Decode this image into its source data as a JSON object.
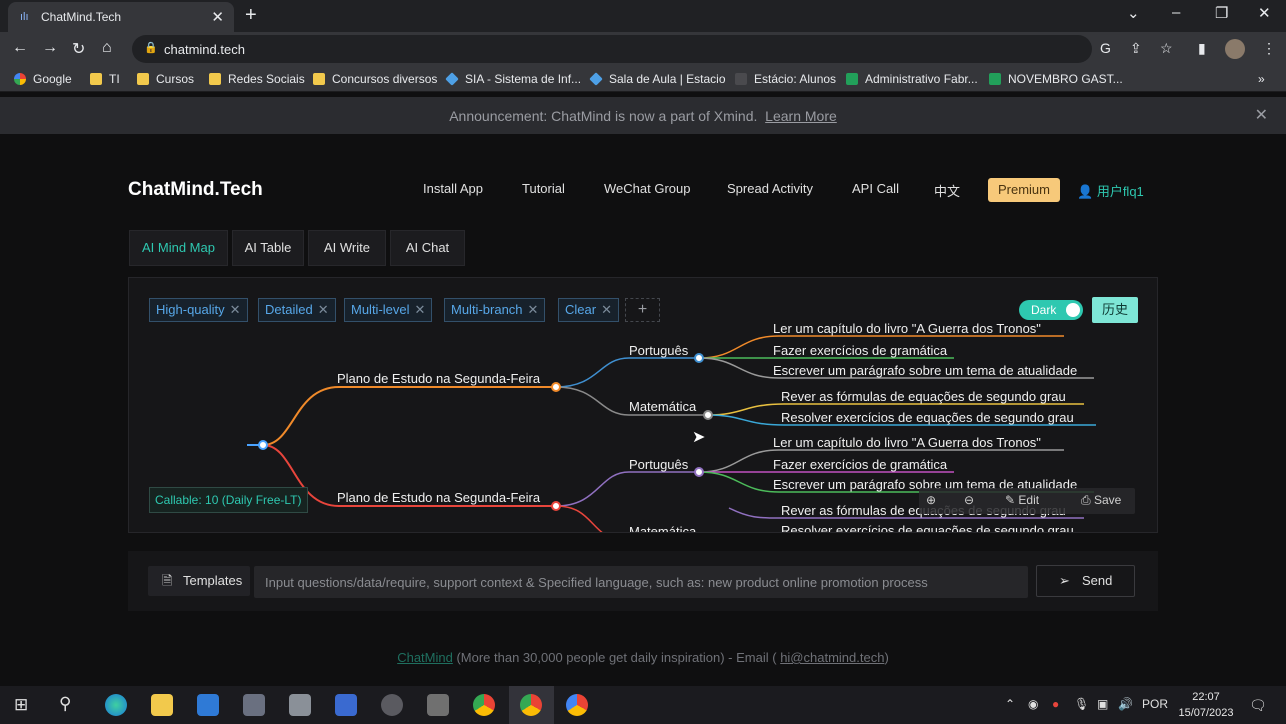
{
  "browser": {
    "tab_title": "ChatMind.Tech",
    "url": "chatmind.tech",
    "bookmarks": [
      "Google",
      "TI",
      "Cursos",
      "Redes Sociais",
      "Concursos diversos",
      "SIA - Sistema de Inf...",
      "Sala de Aula | Estacio",
      "Estácio: Alunos",
      "Administrativo Fabr...",
      "NOVEMBRO GAST..."
    ]
  },
  "announcement": {
    "text": "Announcement: ChatMind is now a part of Xmind.",
    "link": "Learn More"
  },
  "header": {
    "brand": "ChatMind.Tech",
    "nav": [
      "Install App",
      "Tutorial",
      "WeChat Group",
      "Spread Activity",
      "API Call",
      "中文"
    ],
    "premium": "Premium",
    "user": "用户flq1"
  },
  "tabs": [
    "AI Mind Map",
    "AI Table",
    "AI Write",
    "AI Chat"
  ],
  "chips": [
    "High-quality",
    "Detailed",
    "Multi-level",
    "Multi-branch",
    "Clear"
  ],
  "toggle": {
    "label": "Dark"
  },
  "history": "历史",
  "callable": "Callable: 10 (Daily Free-LT)",
  "mindmap": {
    "branches": [
      {
        "label": "Plano de Estudo na Segunda-Feira",
        "children": [
          {
            "label": "Português",
            "leaves": [
              "Ler um capítulo do livro \"A Guerra dos Tronos\"",
              "Fazer exercícios de gramática",
              "Escrever um parágrafo sobre um tema de atualidade"
            ]
          },
          {
            "label": "Matemática",
            "leaves": [
              "Rever as fórmulas de equações de segundo grau",
              "Resolver exercícios de equações de segundo grau"
            ]
          }
        ]
      },
      {
        "label": "Plano de Estudo na Segunda-Feira",
        "children": [
          {
            "label": "Português",
            "leaves": [
              "Ler um capítulo do livro \"A Guerra dos Tronos\"",
              "Fazer exercícios de gramática",
              "Escrever um parágrafo sobre um tema de atualidade"
            ]
          },
          {
            "label": "Matemática",
            "leaves": [
              "Rever as fórmulas de equações de segundo grau",
              "Resolver exercícios de equações de segundo grau"
            ]
          }
        ]
      }
    ]
  },
  "toolbar": {
    "edit": "Edit",
    "save": "Save"
  },
  "input": {
    "templates": "Templates",
    "placeholder": "Input questions/data/require, support context & Specified language, such as: new product online promotion process",
    "send": "Send"
  },
  "footer": {
    "brand": "ChatMind",
    "text": " (More than 30,000 people get daily inspiration) - Email ( ",
    "email": "hi@chatmind.tech",
    "close": ")"
  },
  "taskbar": {
    "lang": "POR",
    "time": "22:07",
    "date": "15/07/2023"
  }
}
